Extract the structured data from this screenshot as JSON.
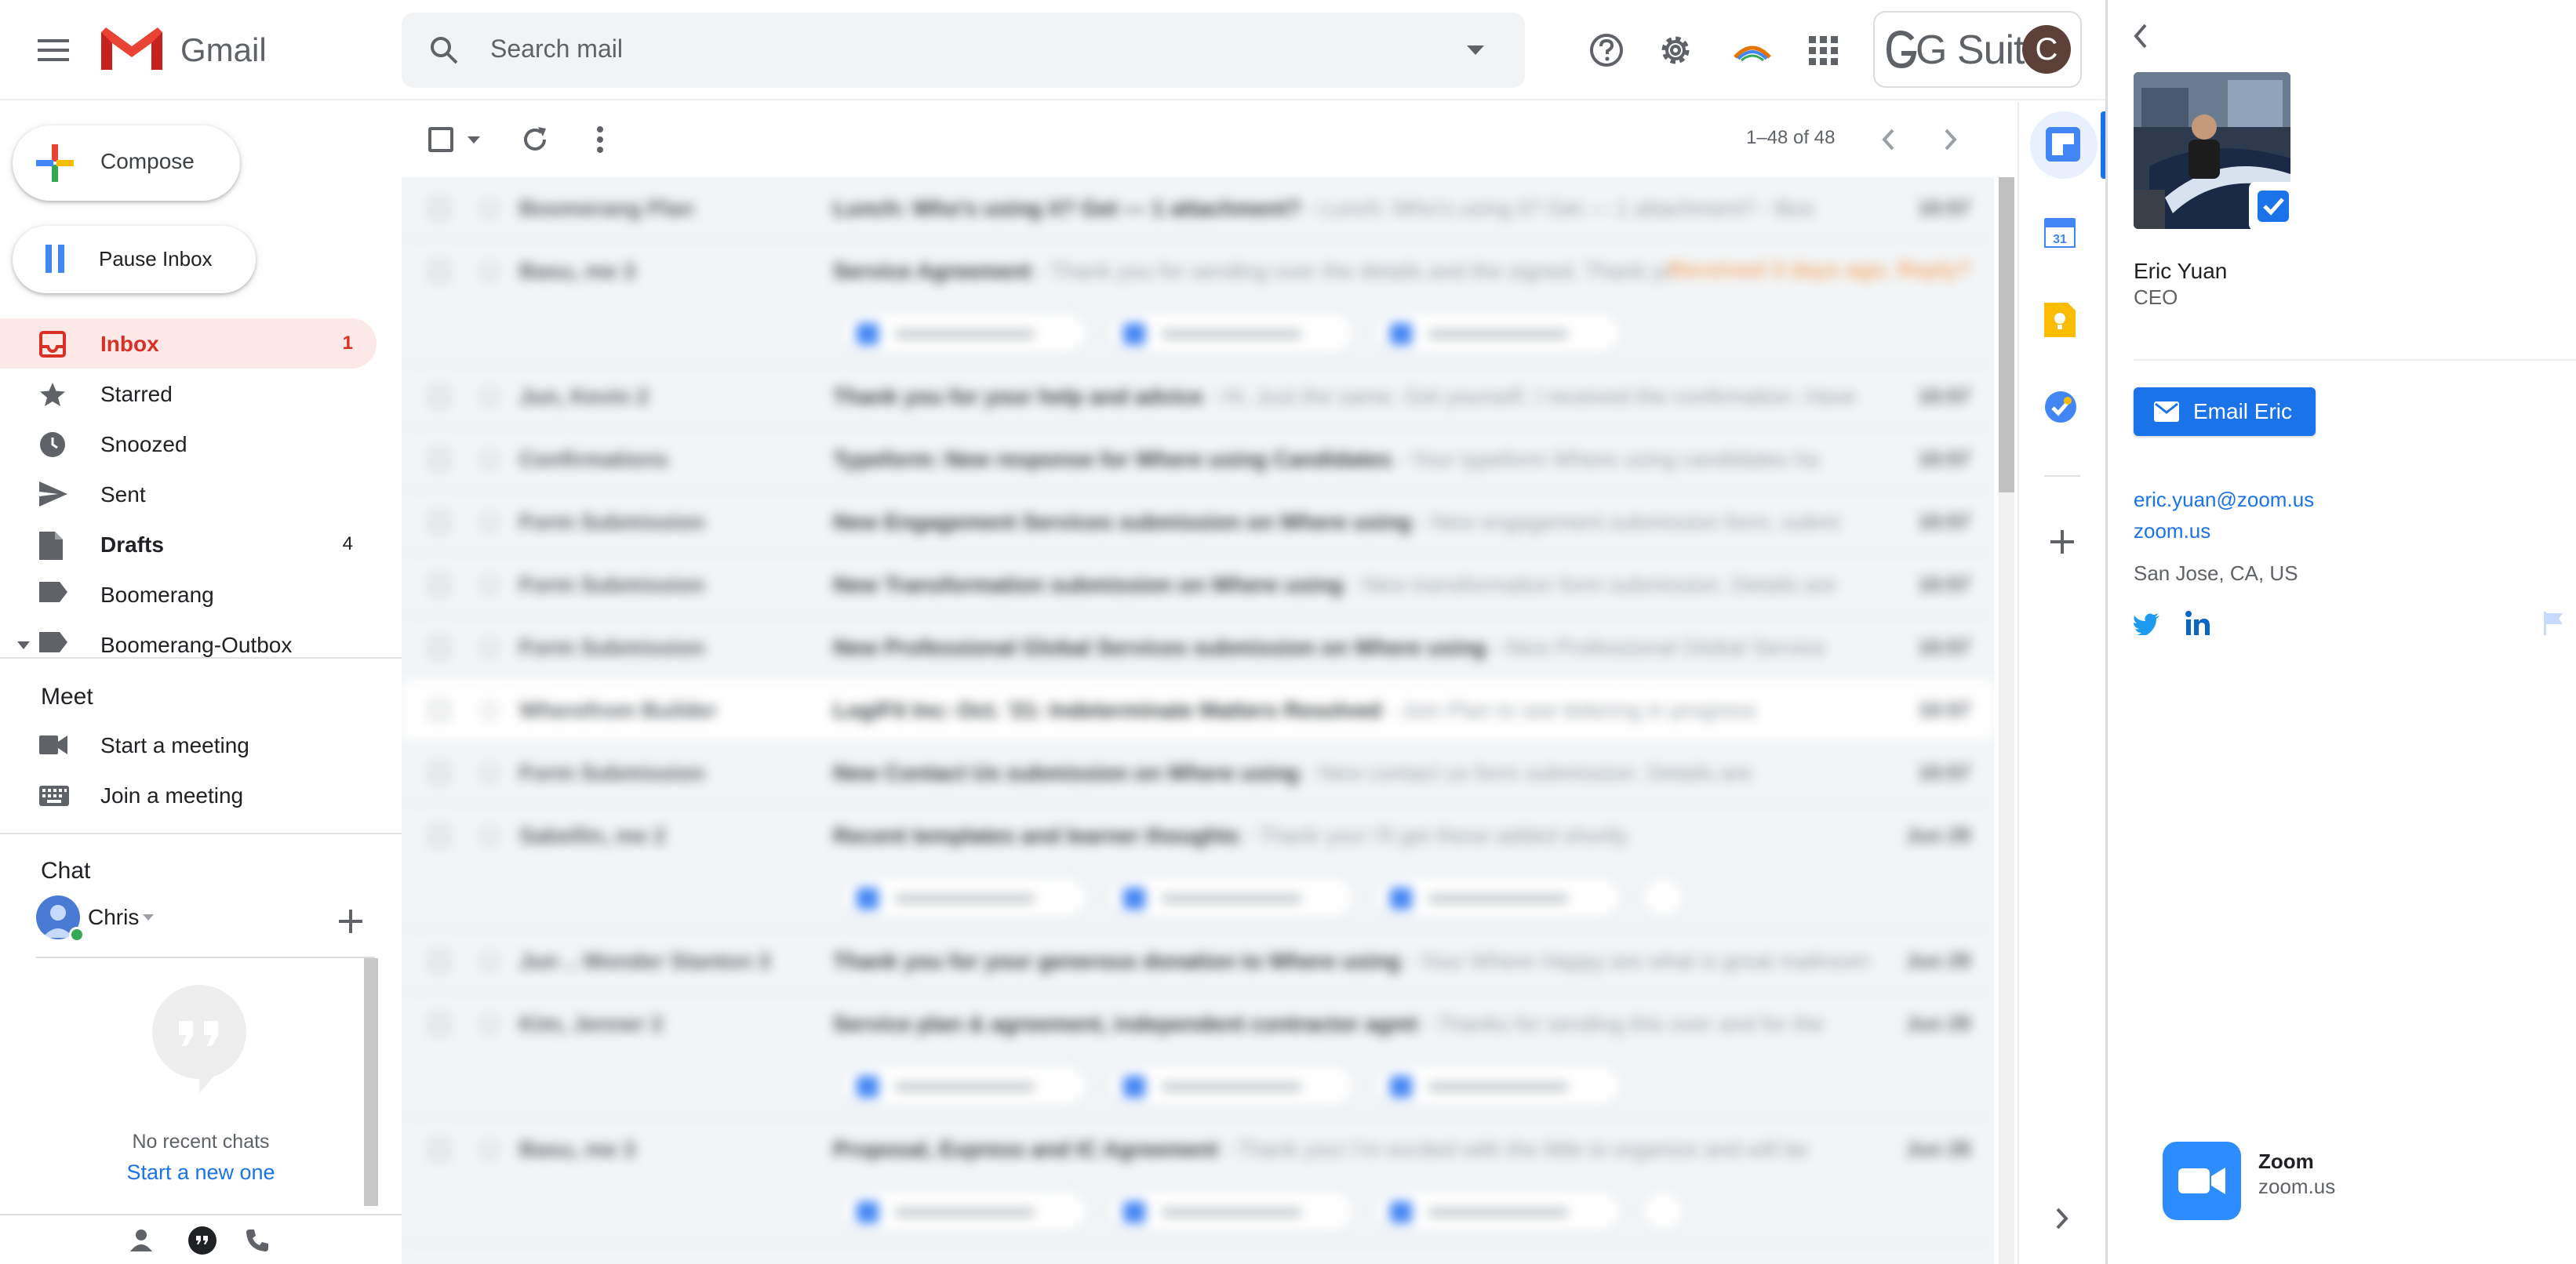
{
  "header": {
    "app_name": "Gmail",
    "search_placeholder": "Search mail",
    "gsuite_label": "G Suite",
    "account_initial": "C"
  },
  "sidebar": {
    "compose_label": "Compose",
    "pause_label": "Pause Inbox",
    "items": [
      {
        "label": "Inbox",
        "count": "1"
      },
      {
        "label": "Starred",
        "count": ""
      },
      {
        "label": "Snoozed",
        "count": ""
      },
      {
        "label": "Sent",
        "count": ""
      },
      {
        "label": "Drafts",
        "count": "4"
      },
      {
        "label": "Boomerang",
        "count": ""
      },
      {
        "label": "Boomerang-Outbox",
        "count": ""
      }
    ],
    "meet": {
      "title": "Meet",
      "start": "Start a meeting",
      "join": "Join a meeting"
    },
    "chat": {
      "title": "Chat",
      "user": "Chris",
      "no_chats": "No recent chats",
      "start_new": "Start a new one"
    }
  },
  "toolbar": {
    "pager": "1–48 of 48"
  },
  "email_list": {
    "rows": [
      {
        "sender": "Boomerang Plan",
        "subject": "Lunch: Who's using it? Get — 1 attachment?",
        "snippet": " - Lunch: Who's using it? Get — 1 attachment? - Boo",
        "date": "10:57",
        "unread": false,
        "chips": 0
      },
      {
        "sender": "Basu, me 3",
        "subject": "Service Agreement",
        "snippet": " - Thank you for sending over the details and the signed. Thank yo",
        "date": "",
        "badge": "Received 3 days ago. Reply?",
        "unread": false,
        "chips": 3
      },
      {
        "sender": "Jun, Kevin 2",
        "subject": "Thank you for your help and advice",
        "snippet": " - Hi, Just the same. Get yourself. I received the confirmation. Have",
        "date": "10:57",
        "unread": false,
        "chips": 0
      },
      {
        "sender": "Confirmations",
        "subject": "Typeform: New response for Where using Candidates",
        "snippet": " - Your typeform Where using candidates ha",
        "date": "10:57",
        "unread": false,
        "chips": 0
      },
      {
        "sender": "Form Submission",
        "subject": "New Engagement Services submission on Where using",
        "snippet": " - New engagement submission form, submi",
        "date": "10:57",
        "unread": false,
        "chips": 0
      },
      {
        "sender": "Form Submission",
        "subject": "New Transformation submission on Where using",
        "snippet": " - New transformation form submission. Details are",
        "date": "10:57",
        "unread": false,
        "chips": 0
      },
      {
        "sender": "Form Submission",
        "subject": "New Professional Global Services submission on Where using",
        "snippet": " - New Professional Global Service",
        "date": "10:57",
        "unread": false,
        "chips": 0
      },
      {
        "sender": "Wherefrom Builder",
        "subject": "LogiFit Inc: Oct. '21: Indeterminate Matters Resolved",
        "snippet": " - Join Plan to see lettering in progress",
        "date": "10:57",
        "unread": true,
        "chips": 0
      },
      {
        "sender": "Form Submission",
        "subject": "New Contact Us submission on Where using",
        "snippet": " - New contact us form submission. Details are",
        "date": "10:57",
        "unread": false,
        "chips": 0
      },
      {
        "sender": "Sabellin, me 2",
        "subject": "Recent templates and learner thoughts",
        "snippet": " - Thank you! I'll get these added shortly",
        "date": "Jun 29",
        "unread": false,
        "chips": 4
      },
      {
        "sender": "Jun .. Wonder Stanton 3",
        "subject": "Thank you for your generous donation to Where using",
        "snippet": " - Your Where Happy are what is great mailroom",
        "date": "Jun 29",
        "unread": false,
        "chips": 0
      },
      {
        "sender": "Kim, Jenner 2",
        "subject": "Service plan & agreement, independent contractor agmt",
        "snippet": " - Thanks for sending this over and for the",
        "date": "Jun 29",
        "unread": false,
        "chips": 3
      },
      {
        "sender": "Basu, me 3",
        "subject": "Proposal, Express and IC Agreement",
        "snippet": " - Thank you! I'm excited with the little to organize and will be",
        "date": "Jun 28",
        "unread": false,
        "chips": 4
      }
    ]
  },
  "contact": {
    "name": "Eric Yuan",
    "role": "CEO",
    "email_button": "Email Eric",
    "email": "eric.yuan@zoom.us",
    "website": "zoom.us",
    "location": "San Jose, CA, US",
    "card_title": "Zoom",
    "card_domain": "zoom.us"
  },
  "colors": {
    "inbox_active_bg": "#fce8e6",
    "inbox_active_text": "#d93025",
    "link_blue": "#1a73e8",
    "zoom_blue": "#2d8cff"
  }
}
